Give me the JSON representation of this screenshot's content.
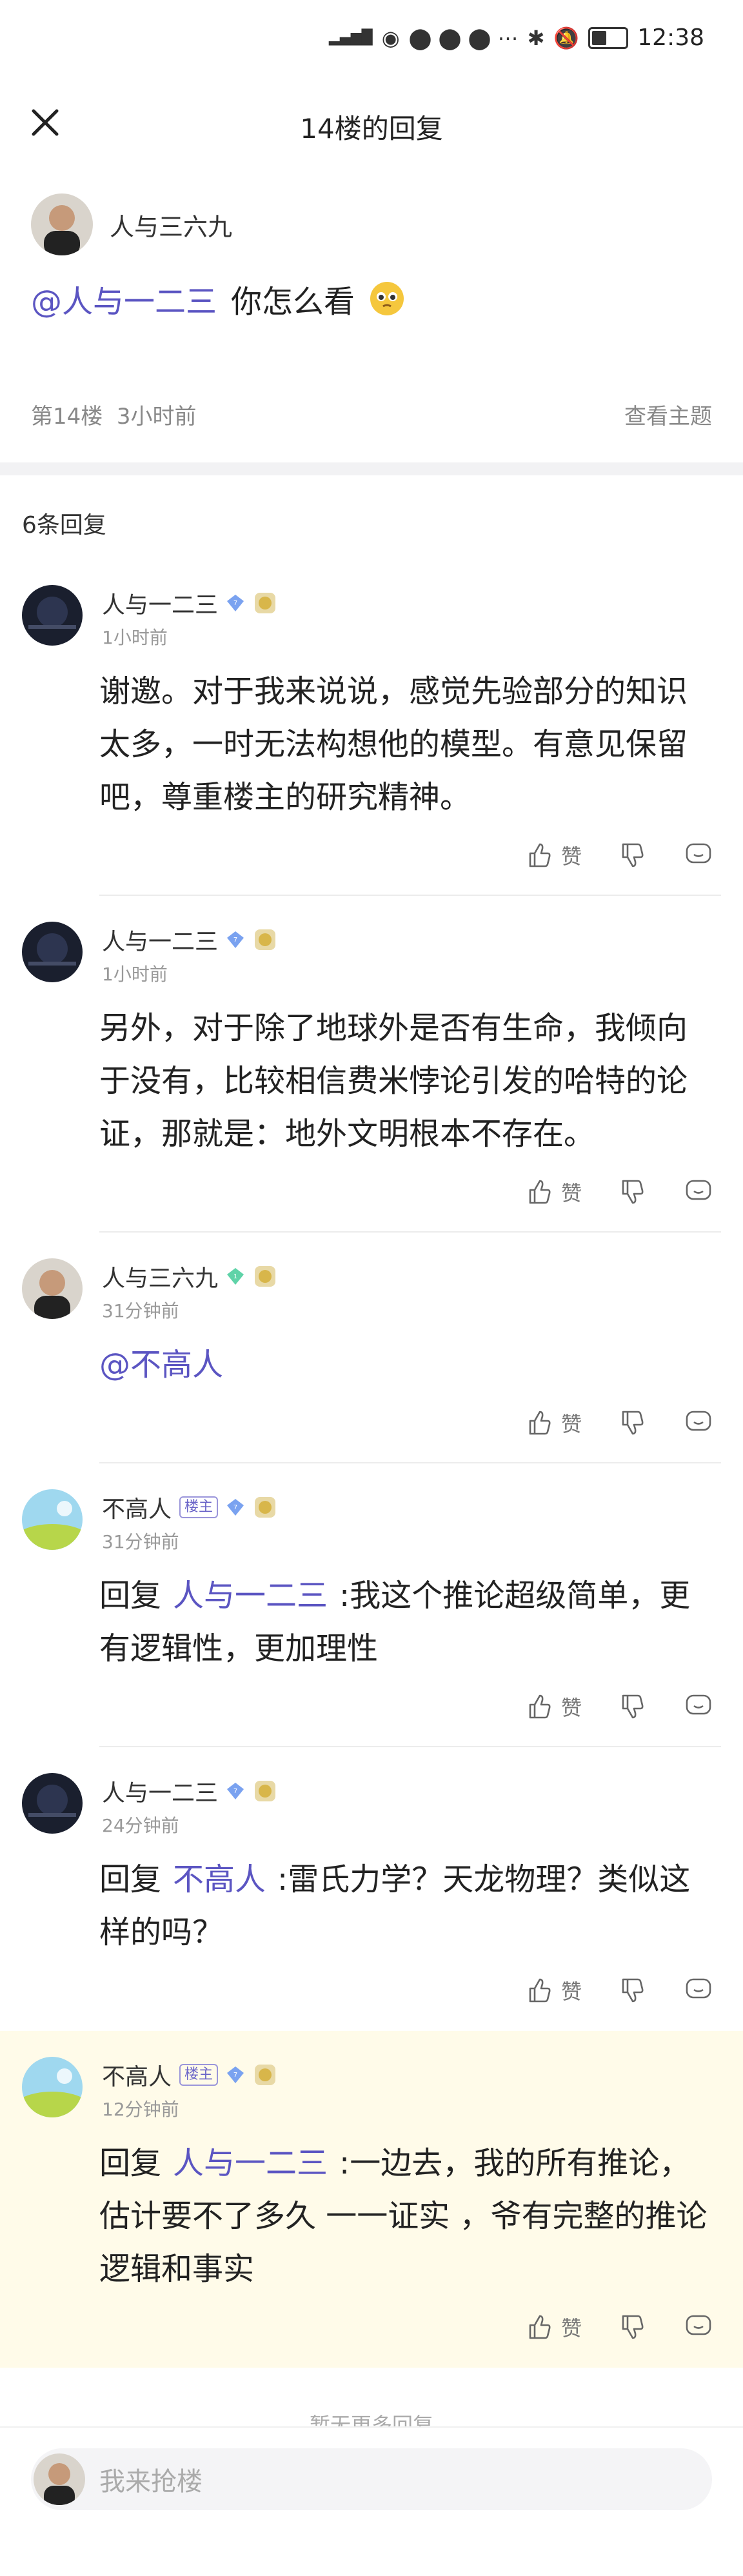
{
  "status_bar": {
    "time": "12:38",
    "signal_text": "HD 5G 4G",
    "colors": {
      "text": "#333333"
    }
  },
  "header": {
    "title": "14楼的回复"
  },
  "op": {
    "user_name": "人与三六九",
    "mention": "@人与一二三",
    "text": "你怎么看",
    "floor": "第14楼",
    "time": "3小时前",
    "view_thread": "查看主题"
  },
  "reply_count": "6条回复",
  "actions": {
    "like": "赞"
  },
  "replies": [
    {
      "name": "人与一二三",
      "badge_lz": "",
      "level": "7",
      "time": "1小时前",
      "prefix": "",
      "mention": "",
      "text": "谢邀。对于我来说说，感觉先验部分的知识太多，一时无法构想他的模型。有意见保留吧，尊重楼主的研究精神。"
    },
    {
      "name": "人与一二三",
      "badge_lz": "",
      "level": "7",
      "time": "1小时前",
      "prefix": "",
      "mention": "",
      "text": "另外，对于除了地球外是否有生命，我倾向于没有，比较相信费米悖论引发的哈特的论证，那就是：地外文明根本不存在。"
    },
    {
      "name": "人与三六九",
      "badge_lz": "",
      "level": "1",
      "time": "31分钟前",
      "prefix": "",
      "mention": "@不高人",
      "text": ""
    },
    {
      "name": "不高人",
      "badge_lz": "楼主",
      "level": "7",
      "time": "31分钟前",
      "prefix": "回复",
      "mention": "人与一二三",
      "text": ":我这个推论超级简单，更有逻辑性，更加理性"
    },
    {
      "name": "人与一二三",
      "badge_lz": "",
      "level": "7",
      "time": "24分钟前",
      "prefix": "回复",
      "mention": "不高人",
      "text": ":雷氏力学？天龙物理？类似这样的吗？"
    },
    {
      "name": "不高人",
      "badge_lz": "楼主",
      "level": "7",
      "time": "12分钟前",
      "prefix": "回复",
      "mention": "人与一二三",
      "text": ":一边去，我的所有推论，估计要不了多久 一一证实 ，爷有完整的推论逻辑和事实"
    }
  ],
  "no_more": "暂无更多回复",
  "bottom_input": {
    "placeholder": "我来抢楼"
  },
  "colors": {
    "accent": "#5b55c2",
    "highlight_bg": "#fffbe9",
    "band": "#f2f2f4"
  }
}
